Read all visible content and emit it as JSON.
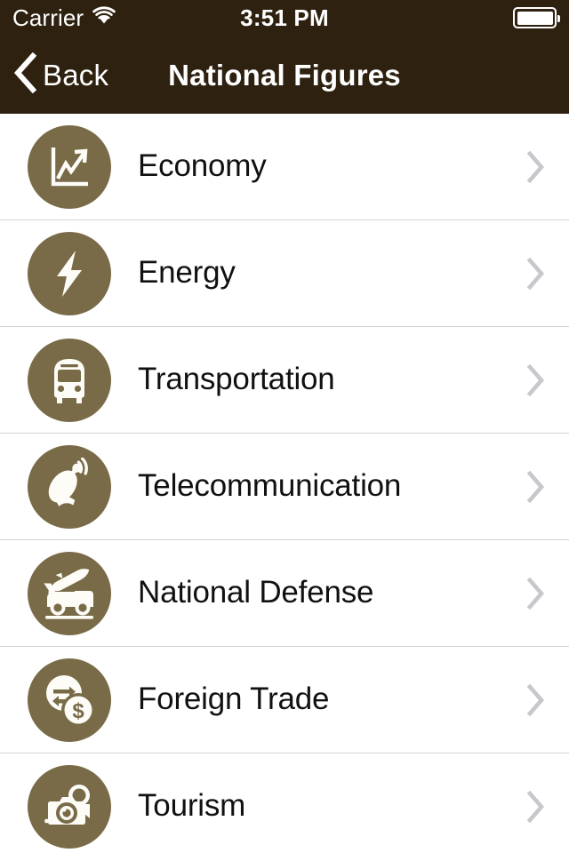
{
  "status_bar": {
    "carrier": "Carrier",
    "wifi_icon": "wifi-icon",
    "time": "3:51 PM",
    "battery_icon": "battery-full-icon"
  },
  "nav_bar": {
    "back_icon": "chevron-left-icon",
    "back_label": "Back",
    "title": "National Figures"
  },
  "colors": {
    "nav_background": "#2e2110",
    "icon_circle": "#796b48",
    "row_background": "#ffffff",
    "separator": "#d3d3d6",
    "chevron": "#c7c7cc",
    "label_text": "#111111",
    "nav_text": "#ffffff"
  },
  "list": {
    "disclosure_icon": "chevron-right-icon",
    "rows": [
      {
        "label": "Economy",
        "icon": "line-chart-icon"
      },
      {
        "label": "Energy",
        "icon": "lightning-bolt-icon"
      },
      {
        "label": "Transportation",
        "icon": "bus-icon"
      },
      {
        "label": "Telecommunication",
        "icon": "satellite-dish-icon"
      },
      {
        "label": "National Defense",
        "icon": "missile-truck-icon"
      },
      {
        "label": "Foreign Trade",
        "icon": "currency-exchange-icon"
      },
      {
        "label": "Tourism",
        "icon": "camera-icon"
      }
    ]
  }
}
